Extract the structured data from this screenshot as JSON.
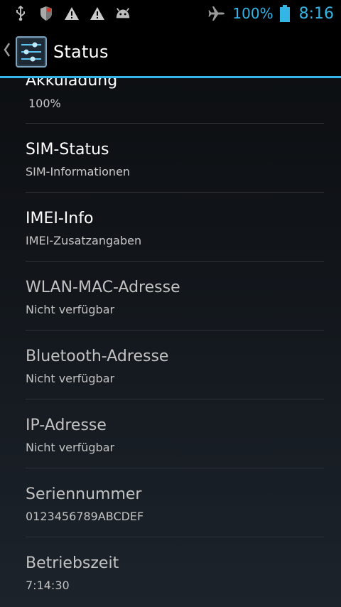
{
  "status_bar": {
    "left_icons": [
      "usb-icon",
      "shield-icon",
      "warning-icon",
      "warning-icon",
      "android-icon"
    ],
    "airplane_icon": "airplane-icon",
    "battery_percent": "100%",
    "battery_icon": "battery-icon",
    "time": "8:16",
    "accent_color": "#33b5e5"
  },
  "action_bar": {
    "back_icon": "chevron-left-icon",
    "app_icon": "settings-sliders-icon",
    "title": "Status"
  },
  "items": [
    {
      "title": "Akkuladung",
      "subtitle": "100%",
      "enabled": true
    },
    {
      "title": "SIM-Status",
      "subtitle": "SIM-Informationen",
      "enabled": true
    },
    {
      "title": "IMEI-Info",
      "subtitle": "IMEI-Zusatzangaben",
      "enabled": true
    },
    {
      "title": "WLAN-MAC-Adresse",
      "subtitle": "Nicht verfügbar",
      "enabled": false
    },
    {
      "title": "Bluetooth-Adresse",
      "subtitle": "Nicht verfügbar",
      "enabled": false
    },
    {
      "title": "IP-Adresse",
      "subtitle": "Nicht verfügbar",
      "enabled": false
    },
    {
      "title": "Seriennummer",
      "subtitle": "0123456789ABCDEF",
      "enabled": false
    },
    {
      "title": "Betriebszeit",
      "subtitle": "7:14:30",
      "enabled": false
    }
  ]
}
